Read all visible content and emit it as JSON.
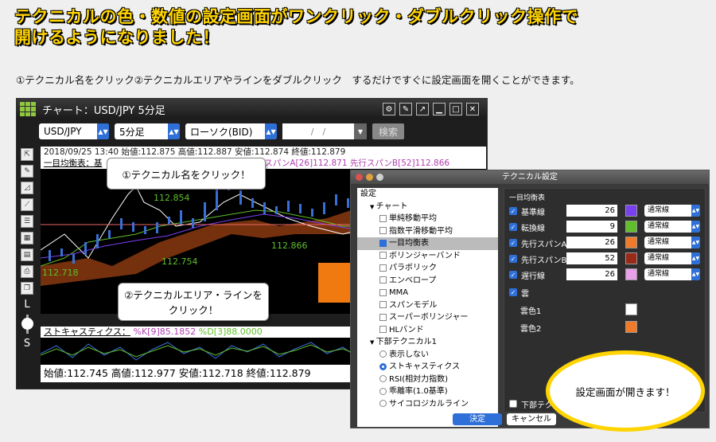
{
  "headline": {
    "line1": "テクニカルの色・数値の設定画面がワンクリック・ダブルクリック操作で",
    "line2": "開けるようになりました！"
  },
  "subline": "①テクニカル名をクリック②テクニカルエリアやラインをダブルクリック　するだけですぐに設定画面を開くことができます。",
  "window": {
    "title": "チャート：USD/JPY 5分足",
    "pair": "USD/JPY",
    "timeframe": "5分足",
    "candle": "ローソク(BID)",
    "date_placeholder": "/　/",
    "search": "検索",
    "info_line": "2018/09/25 13:40 始値:112.875 高値:112.887 安値:112.874 終値:112.879",
    "ichimoku_line": "一目均衡表：基",
    "ichimoku_tail": "行スパンA[26]112.871 先行スパンB[52]112.866",
    "price_labels": [
      "112.854",
      "112.754",
      "112.718",
      "112.866"
    ],
    "stoch_label": "ストキャスティクス：",
    "stoch_k": "%K[9]85.1852",
    "stoch_d": "%D[3]88.0000",
    "bottom": "始値:112.745 高値:112.977 安値:112.718 終値:112.879",
    "zoom_L": "L",
    "zoom_S": "S"
  },
  "bubbles": {
    "b1": "①テクニカル名をクリック！",
    "b2_l1": "②テクニカルエリア・ラインを",
    "b2_l2": "クリック！",
    "done": "設定画面が開きます！"
  },
  "dialog": {
    "title": "テクニカル設定",
    "tree": [
      {
        "text": "設定",
        "level": 0,
        "kind": "head"
      },
      {
        "text": "チャート",
        "level": 1,
        "kind": "head"
      },
      {
        "text": "単純移動平均",
        "level": 2,
        "kind": "check",
        "on": false
      },
      {
        "text": "指数平滑移動平均",
        "level": 2,
        "kind": "check",
        "on": false
      },
      {
        "text": "一目均衡表",
        "level": 2,
        "kind": "check",
        "on": true,
        "selected": true
      },
      {
        "text": "ボリンジャーバンド",
        "level": 2,
        "kind": "check",
        "on": false
      },
      {
        "text": "パラボリック",
        "level": 2,
        "kind": "check",
        "on": false
      },
      {
        "text": "エンベロープ",
        "level": 2,
        "kind": "check",
        "on": false
      },
      {
        "text": "MMA",
        "level": 2,
        "kind": "check",
        "on": false
      },
      {
        "text": "スパンモデル",
        "level": 2,
        "kind": "check",
        "on": false
      },
      {
        "text": "スーパーボリンジャー",
        "level": 2,
        "kind": "check",
        "on": false
      },
      {
        "text": "HLバンド",
        "level": 2,
        "kind": "check",
        "on": false
      },
      {
        "text": "下部テクニカル1",
        "level": 1,
        "kind": "head"
      },
      {
        "text": "表示しない",
        "level": 2,
        "kind": "radio",
        "on": false
      },
      {
        "text": "ストキャスティクス",
        "level": 2,
        "kind": "radio",
        "on": true
      },
      {
        "text": "RSI(相対力指数)",
        "level": 2,
        "kind": "radio",
        "on": false
      },
      {
        "text": "乖離率(1.0基準)",
        "level": 2,
        "kind": "radio",
        "on": false
      },
      {
        "text": "サイコロジカルライン",
        "level": 2,
        "kind": "radio",
        "on": false
      }
    ],
    "section": "一目均衡表",
    "rows": [
      {
        "label": "基準線",
        "value": "26",
        "color": "#7a3ff0",
        "line": "通常線"
      },
      {
        "label": "転換線",
        "value": "9",
        "color": "#5fbf2a",
        "line": "通常線"
      },
      {
        "label": "先行スパンA",
        "value": "26",
        "color": "#f07a28",
        "line": "通常線"
      },
      {
        "label": "先行スパンB",
        "value": "52",
        "color": "#9a2a18",
        "line": "通常線"
      },
      {
        "label": "遅行線",
        "value": "26",
        "color": "#e8a0e8",
        "line": "通常線"
      }
    ],
    "cloud": "雲",
    "cloud1": "雲色1",
    "cloud1_color": "#ffffff",
    "cloud2": "雲色2",
    "cloud2_color": "#f07a28",
    "bottom_check": "下部テクニ",
    "ok": "決定",
    "cancel": "キャンセル"
  }
}
